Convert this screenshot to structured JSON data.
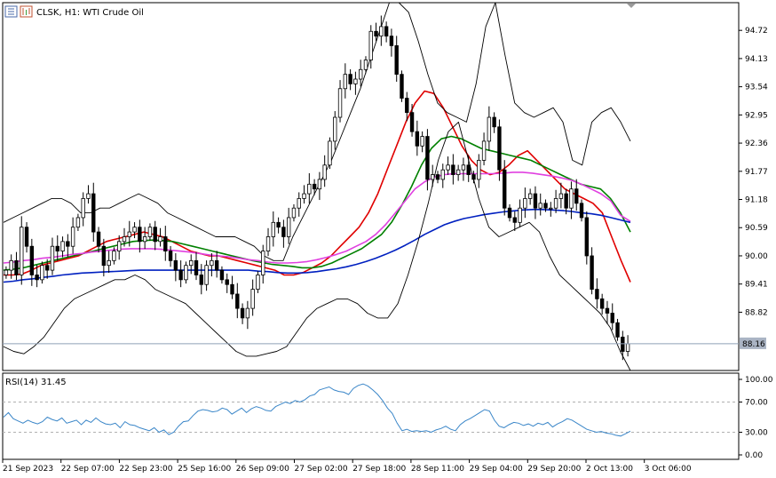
{
  "chart_data": [
    {
      "type": "candlestick",
      "title": "CLSK, H1:  WTI Crude Oil",
      "ylim": [
        87.6,
        95.3
      ],
      "y_ticks": [
        "94.72",
        "94.13",
        "93.54",
        "92.95",
        "92.36",
        "91.77",
        "91.18",
        "90.59",
        "90.00",
        "89.41",
        "88.82"
      ],
      "current_price": "88.16",
      "x_ticks": [
        "21 Sep 2023",
        "22 Sep 07:00",
        "22 Sep 23:00",
        "25 Sep 16:00",
        "26 Sep 09:00",
        "27 Sep 02:00",
        "27 Sep 18:00",
        "28 Sep 11:00",
        "29 Sep 04:00",
        "29 Sep 20:00",
        "2 Oct 13:00",
        "3 Oct 06:00"
      ],
      "closes": [
        89.7,
        89.9,
        89.6,
        90.6,
        90.2,
        89.6,
        89.5,
        89.8,
        89.7,
        90.2,
        90.1,
        90.3,
        90.2,
        90.6,
        90.8,
        91.2,
        91.3,
        90.5,
        90.2,
        89.8,
        89.9,
        90.1,
        90.3,
        90.4,
        90.5,
        90.6,
        90.3,
        90.4,
        90.6,
        90.3,
        90.4,
        90.1,
        89.9,
        89.7,
        89.5,
        89.8,
        89.9,
        89.6,
        89.4,
        89.8,
        89.9,
        89.7,
        89.5,
        89.4,
        89.2,
        88.9,
        88.7,
        88.9,
        89.3,
        89.6,
        90.1,
        90.4,
        90.7,
        90.6,
        90.4,
        90.8,
        91.0,
        91.2,
        91.3,
        91.5,
        91.4,
        91.6,
        91.9,
        92.4,
        92.9,
        93.5,
        93.8,
        93.6,
        93.7,
        93.9,
        94.1,
        94.7,
        94.6,
        94.8,
        94.6,
        94.4,
        93.8,
        93.3,
        93.0,
        92.6,
        92.3,
        92.5,
        91.6,
        91.7,
        91.6,
        91.8,
        91.9,
        91.7,
        91.8,
        91.9,
        91.7,
        91.6,
        92.0,
        92.4,
        92.9,
        92.7,
        91.8,
        91.0,
        90.8,
        90.7,
        91.0,
        91.2,
        91.3,
        91.0,
        91.1,
        91.0,
        91.0,
        91.2,
        91.3,
        91.0,
        91.4,
        91.1,
        90.8,
        90.0,
        89.3,
        89.1,
        88.9,
        88.8,
        88.6,
        88.3,
        88.0,
        88.16
      ],
      "series": [
        {
          "name": "",
          "color": "#e00000",
          "values": [
            89.6,
            89.6,
            89.62,
            89.7,
            89.8,
            89.85,
            89.9,
            89.95,
            90.0,
            90.1,
            90.2,
            90.3,
            90.35,
            90.4,
            90.45,
            90.5,
            90.45,
            90.4,
            90.3,
            90.2,
            90.1,
            90.05,
            90.0,
            90.0,
            89.95,
            89.9,
            89.85,
            89.8,
            89.75,
            89.7,
            89.6,
            89.6,
            89.65,
            89.75,
            89.85,
            90.0,
            90.2,
            90.4,
            90.6,
            90.9,
            91.3,
            91.8,
            92.3,
            92.8,
            93.2,
            93.45,
            93.4,
            93.1,
            92.7,
            92.3,
            92.0,
            91.8,
            91.7,
            91.75,
            91.9,
            92.1,
            92.2,
            92.0,
            91.8,
            91.6,
            91.4,
            91.3,
            91.2,
            91.1,
            90.9,
            90.4,
            89.9,
            89.45
          ]
        },
        {
          "name": "",
          "color": "#008000",
          "values": [
            89.7,
            89.72,
            89.75,
            89.8,
            89.85,
            89.9,
            89.95,
            90.0,
            90.05,
            90.1,
            90.15,
            90.2,
            90.25,
            90.3,
            90.32,
            90.33,
            90.32,
            90.3,
            90.25,
            90.2,
            90.15,
            90.1,
            90.05,
            90.0,
            89.95,
            89.9,
            89.86,
            89.82,
            89.8,
            89.78,
            89.75,
            89.75,
            89.78,
            89.85,
            89.95,
            90.05,
            90.15,
            90.3,
            90.45,
            90.7,
            91.05,
            91.45,
            91.9,
            92.25,
            92.45,
            92.5,
            92.45,
            92.35,
            92.25,
            92.2,
            92.15,
            92.1,
            92.05,
            92.0,
            91.9,
            91.8,
            91.7,
            91.6,
            91.5,
            91.45,
            91.4,
            91.2,
            90.9,
            90.5
          ]
        },
        {
          "name": "",
          "color": "#e040e0",
          "values": [
            89.85,
            89.87,
            89.9,
            89.92,
            89.95,
            89.97,
            90.0,
            90.03,
            90.05,
            90.08,
            90.1,
            90.12,
            90.14,
            90.15,
            90.15,
            90.15,
            90.14,
            90.12,
            90.1,
            90.08,
            90.05,
            90.02,
            90.0,
            89.98,
            89.95,
            89.92,
            89.9,
            89.87,
            89.85,
            89.85,
            89.86,
            89.88,
            89.92,
            89.97,
            90.03,
            90.1,
            90.2,
            90.3,
            90.45,
            90.65,
            90.9,
            91.15,
            91.4,
            91.55,
            91.65,
            91.7,
            91.72,
            91.72,
            91.72,
            91.72,
            91.72,
            91.73,
            91.75,
            91.75,
            91.73,
            91.7,
            91.67,
            91.63,
            91.58,
            91.5,
            91.4,
            91.3,
            91.15,
            90.85,
            90.72
          ]
        },
        {
          "name": "",
          "color": "#0020c0",
          "values": [
            89.45,
            89.47,
            89.5,
            89.52,
            89.55,
            89.57,
            89.6,
            89.62,
            89.64,
            89.65,
            89.66,
            89.67,
            89.68,
            89.69,
            89.7,
            89.7,
            89.7,
            89.7,
            89.7,
            89.7,
            89.7,
            89.7,
            89.7,
            89.7,
            89.7,
            89.7,
            89.68,
            89.67,
            89.65,
            89.64,
            89.64,
            89.65,
            89.67,
            89.7,
            89.73,
            89.77,
            89.82,
            89.88,
            89.95,
            90.03,
            90.12,
            90.22,
            90.33,
            90.45,
            90.55,
            90.65,
            90.72,
            90.78,
            90.82,
            90.86,
            90.89,
            90.92,
            90.94,
            90.96,
            90.97,
            90.97,
            90.96,
            90.95,
            90.93,
            90.9,
            90.88,
            90.85,
            90.8,
            90.75,
            90.7
          ]
        },
        {
          "name": "",
          "color": "#000000",
          "values": [
            90.7,
            90.8,
            90.9,
            91.0,
            91.1,
            91.2,
            91.2,
            91.1,
            90.9,
            90.9,
            91.0,
            91.0,
            91.1,
            91.2,
            91.3,
            91.2,
            91.1,
            90.9,
            90.8,
            90.7,
            90.6,
            90.5,
            90.4,
            90.4,
            90.4,
            90.3,
            90.2,
            90.0,
            89.9,
            89.9,
            90.4,
            90.8,
            91.2,
            91.6,
            92.0,
            92.5,
            93.0,
            93.5,
            94.1,
            94.7,
            95.3,
            95.3,
            95.1,
            94.5,
            93.8,
            93.2,
            93.0,
            92.9,
            92.8,
            93.6,
            94.8,
            95.3,
            94.2,
            93.2,
            93.0,
            92.9,
            93.0,
            93.1,
            92.8,
            92.0,
            91.9,
            92.8,
            93.0,
            93.1,
            92.8,
            92.4
          ]
        },
        {
          "name": "",
          "color": "#000000",
          "values": [
            88.1,
            88.0,
            87.95,
            88.1,
            88.3,
            88.6,
            88.9,
            89.1,
            89.2,
            89.3,
            89.4,
            89.5,
            89.5,
            89.6,
            89.5,
            89.3,
            89.2,
            89.1,
            89.0,
            88.8,
            88.6,
            88.4,
            88.2,
            88.0,
            87.9,
            87.9,
            87.95,
            88.0,
            88.1,
            88.4,
            88.7,
            88.9,
            89.0,
            89.1,
            89.1,
            89.0,
            88.8,
            88.7,
            88.7,
            89.0,
            89.6,
            90.3,
            91.1,
            92.0,
            92.6,
            92.8,
            92.0,
            91.2,
            90.6,
            90.4,
            90.5,
            90.6,
            90.7,
            90.5,
            90.0,
            89.6,
            89.4,
            89.2,
            89.0,
            88.8,
            88.5,
            88.0,
            87.6
          ]
        }
      ]
    },
    {
      "type": "line",
      "title": "RSI(14) 31.45",
      "ylim": [
        0,
        100
      ],
      "y_ticks": [
        "100.00",
        "70.00",
        "30.00",
        "0.00"
      ],
      "levels": [
        70,
        30
      ],
      "series": [
        {
          "name": "",
          "color": "#3a86c8",
          "values": [
            50,
            56,
            48,
            45,
            42,
            46,
            43,
            41,
            44,
            50,
            47,
            45,
            49,
            42,
            44,
            46,
            40,
            46,
            43,
            49,
            44,
            41,
            40,
            42,
            36,
            44,
            40,
            39,
            36,
            34,
            32,
            36,
            30,
            33,
            27,
            30,
            38,
            44,
            45,
            52,
            58,
            60,
            59,
            57,
            58,
            62,
            60,
            54,
            58,
            62,
            56,
            61,
            64,
            62,
            59,
            58,
            64,
            67,
            70,
            68,
            72,
            70,
            73,
            78,
            80,
            86,
            88,
            90,
            86,
            84,
            83,
            80,
            88,
            92,
            94,
            91,
            86,
            80,
            72,
            62,
            55,
            42,
            32,
            34,
            31,
            32,
            31,
            32,
            30,
            33,
            35,
            38,
            34,
            32,
            40,
            45,
            48,
            52,
            56,
            60,
            58,
            46,
            38,
            36,
            40,
            43,
            42,
            39,
            41,
            38,
            42,
            40,
            43,
            37,
            41,
            44,
            48,
            46,
            42,
            38,
            34,
            32,
            30,
            31,
            29,
            28,
            26,
            25,
            28,
            31.45
          ]
        }
      ]
    }
  ]
}
